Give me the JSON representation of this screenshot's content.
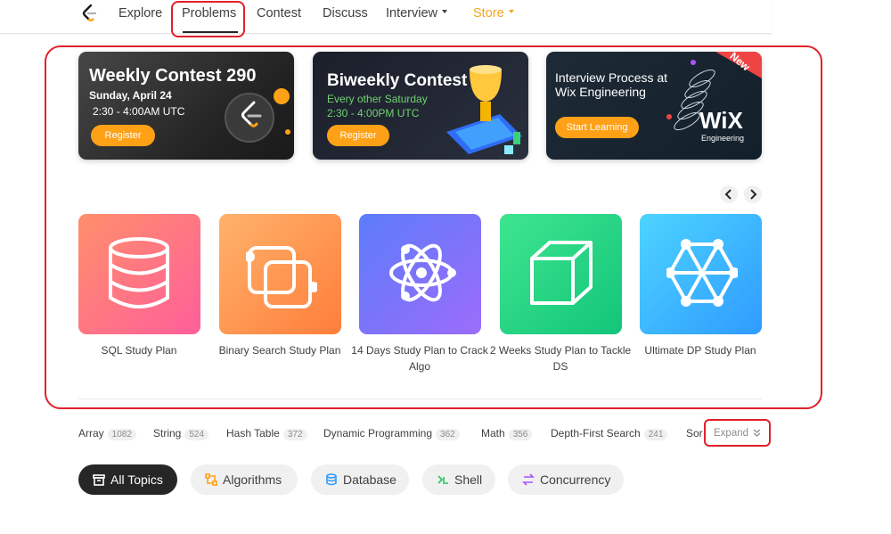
{
  "nav": {
    "items": [
      "Explore",
      "Problems",
      "Contest",
      "Discuss",
      "Interview",
      "Store"
    ]
  },
  "banners": [
    {
      "title": "Weekly Contest 290",
      "line1": "Sunday, April 24",
      "line2": "2:30 - 4:00AM UTC",
      "button": "Register"
    },
    {
      "title": "Biweekly Contest",
      "line1": "Every other Saturday",
      "line2": "2:30 - 4:00PM UTC",
      "button": "Register"
    },
    {
      "title": "Interview Process at",
      "line1": "Wix Engineering",
      "button": "Start Learning",
      "badge": "New",
      "brand": "WiX",
      "brand_sub": "Engineering"
    }
  ],
  "study_plans": [
    {
      "label": "SQL Study Plan",
      "icon": "database-icon"
    },
    {
      "label": "Binary Search Study Plan",
      "icon": "squares-icon"
    },
    {
      "label": "14 Days Study Plan to Crack Algo",
      "icon": "atom-icon"
    },
    {
      "label": "2 Weeks Study Plan to Tackle DS",
      "icon": "cube-icon"
    },
    {
      "label": "Ultimate DP Study Plan",
      "icon": "graph-icon"
    }
  ],
  "tags": [
    {
      "name": "Array",
      "count": "1082"
    },
    {
      "name": "String",
      "count": "524"
    },
    {
      "name": "Hash Table",
      "count": "372"
    },
    {
      "name": "Dynamic Programming",
      "count": "362"
    },
    {
      "name": "Math",
      "count": "356"
    },
    {
      "name": "Depth-First Search",
      "count": "241"
    },
    {
      "name": "Sor",
      "count": ""
    }
  ],
  "expand_label": "Expand",
  "topics": [
    "All Topics",
    "Algorithms",
    "Database",
    "Shell",
    "Concurrency"
  ],
  "colors": {
    "accent": "#ffa116",
    "annotation": "#e0212a",
    "active_pill": "#262626"
  }
}
